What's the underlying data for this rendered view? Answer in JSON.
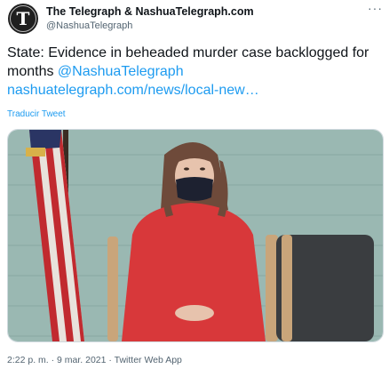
{
  "tweet": {
    "author_name": "The Telegraph & NashuaTelegraph.com",
    "author_handle": "@NashuaTelegraph",
    "text_main": "State: Evidence in beheaded murder case backlogged for months ",
    "mention": "@NashuaTelegraph",
    "url": "nashuatelegraph.com/news/local-new…",
    "translate_label": "Traducir Tweet",
    "timestamp": "2:22 p. m. · 9 mar. 2021 · Twitter Web App"
  },
  "icons": {
    "avatar": "newspaper-logo-icon",
    "more": "more-dots-icon"
  },
  "colors": {
    "link": "#1d9bf0",
    "secondary_text": "#536471",
    "wall": "#9ab8b2",
    "sweater": "#d8383a",
    "chair_seat": "#3a3d40",
    "chair_wood": "#c9a57a"
  }
}
